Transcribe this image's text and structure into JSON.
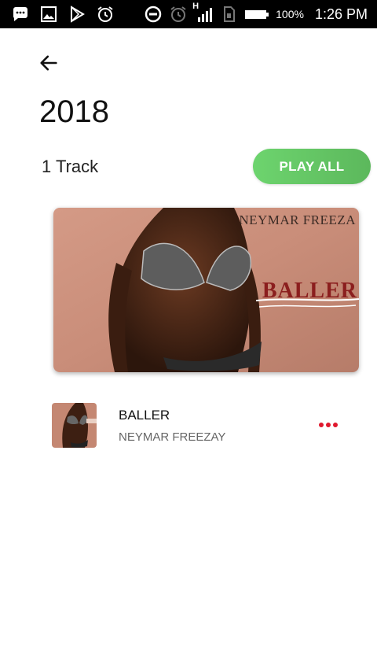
{
  "status_bar": {
    "left_icons": [
      "messenger-icon",
      "gallery-icon",
      "play-store-icon",
      "alarm-icon"
    ],
    "right_icons": [
      "do-not-disturb-icon",
      "alarm-icon",
      "signal-icon",
      "sim-icon",
      "battery-icon"
    ],
    "network_label": "H",
    "battery_percent": "100%",
    "time": "1:26 PM"
  },
  "header": {
    "title": "2018"
  },
  "summary": {
    "track_count": "1 Track",
    "play_all_label": "PLAY ALL"
  },
  "cover": {
    "artist_text": "NEYMAR FREEZA",
    "song_text": "BALLER"
  },
  "tracks": [
    {
      "title": "BALLER",
      "artist": "NEYMAR FREEZAY"
    }
  ],
  "colors": {
    "accent_green": "#5cb85c",
    "menu_red": "#e0182d",
    "status_bar": "#000000"
  }
}
